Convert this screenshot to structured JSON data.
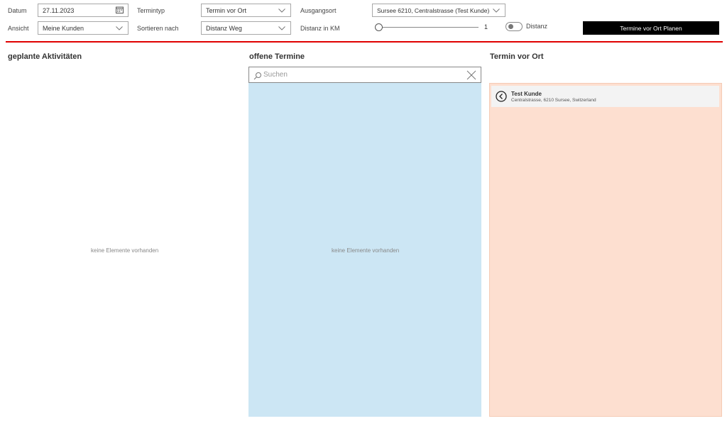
{
  "filters": {
    "datum_label": "Datum",
    "datum_value": "27.11.2023",
    "ansicht_label": "Ansicht",
    "ansicht_value": "Meine Kunden",
    "termintyp_label": "Termintyp",
    "termintyp_value": "Termin vor Ort",
    "sortieren_label": "Sortieren nach",
    "sortieren_value": "Distanz Weg",
    "ausgangsort_label": "Ausgangsort",
    "ausgangsort_value": "Sursee 6210, Centralstrasse (Test Kunde)",
    "distanz_km_label": "Distanz in KM",
    "distanz_km_value": "1",
    "distanz_toggle_label": "Distanz",
    "plan_button": "Termine vor Ort Planen"
  },
  "columns": {
    "geplante": {
      "title": "geplante Aktivitäten",
      "empty": "keine Elemente vorhanden"
    },
    "offene": {
      "title": "offene Termine",
      "search_placeholder": "Suchen",
      "empty": "keine Elemente vorhanden"
    },
    "vor_ort": {
      "title": "Termin vor Ort",
      "items": [
        {
          "name": "Test Kunde",
          "address": "Centralstrasse, 6210 Sursee, Switzerland"
        }
      ]
    }
  },
  "colors": {
    "accent_red": "#e00000",
    "offene_panel": "#cce6f4",
    "vor_ort_panel": "#fddfd0",
    "button_bg": "#000000"
  },
  "icons": [
    "calendar-icon",
    "chevron-down-icon",
    "search-icon",
    "close-icon",
    "back-arrow-icon"
  ]
}
